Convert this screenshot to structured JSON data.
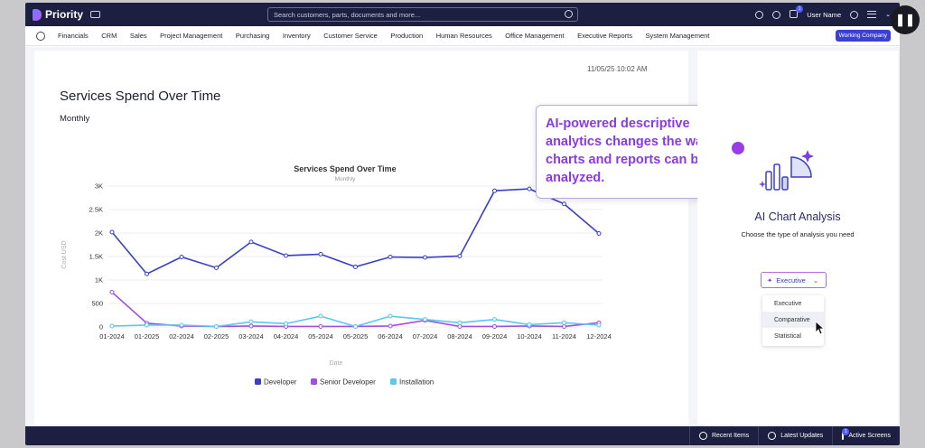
{
  "app": {
    "name": "Priority"
  },
  "search": {
    "placeholder": "Search customers, parts, documents and more..."
  },
  "header": {
    "user_name": "User Name",
    "notification_count": "1"
  },
  "nav": {
    "items": [
      "Financials",
      "CRM",
      "Sales",
      "Project Management",
      "Purchasing",
      "Inventory",
      "Customer Service",
      "Production",
      "Human Resources",
      "Office Management",
      "Executive Reports",
      "System Management"
    ],
    "company_button": "Working Company"
  },
  "report": {
    "timestamp": "11/05/25 10:02 AM",
    "title": "Services Spend Over Time",
    "subtitle": "Monthly"
  },
  "callout": {
    "text": "AI-powered descriptive analytics changes the way charts and reports can be analyzed."
  },
  "ai_panel": {
    "title": "AI Chart Analysis",
    "subtitle": "Choose the type of analysis you need",
    "selected": "Executive",
    "options": [
      "Executive",
      "Comparative",
      "Statistical"
    ]
  },
  "footer": {
    "recent": "Recent Items",
    "updates": "Latest Updates",
    "active": "Active Screens",
    "active_count": "1"
  },
  "colors": {
    "accent": "#3c3fd6",
    "developer": "#3b3fc4",
    "senior_developer": "#a24ee0",
    "installation": "#5ac8f0",
    "callout_text": "#8b3ae2"
  },
  "chart_data": {
    "type": "line",
    "title": "Services Spend Over Time",
    "subtitle": "Monthly",
    "xlabel": "Date",
    "ylabel": "Cost USD",
    "ylim": [
      0,
      3000
    ],
    "yticks": [
      "0",
      "500",
      "1K",
      "1.5K",
      "2K",
      "2.5K",
      "3K"
    ],
    "grid": true,
    "legend_position": "bottom",
    "categories": [
      "01-2024",
      "01-2025",
      "02-2024",
      "02-2025",
      "03-2024",
      "04-2024",
      "05-2024",
      "05-2025",
      "06-2024",
      "07-2024",
      "08-2024",
      "09-2024",
      "10-2024",
      "11-2024",
      "12-2024"
    ],
    "series": [
      {
        "name": "Developer",
        "color": "#3b3fc4",
        "values": [
          2020,
          1130,
          1490,
          1260,
          1810,
          1520,
          1550,
          1280,
          1490,
          1480,
          1510,
          2900,
          2940,
          2620,
          1990
        ]
      },
      {
        "name": "Senior Developer",
        "color": "#a24ee0",
        "values": [
          740,
          80,
          20,
          10,
          20,
          10,
          10,
          10,
          20,
          140,
          10,
          10,
          20,
          10,
          90
        ]
      },
      {
        "name": "Installation",
        "color": "#5ac8f0",
        "values": [
          20,
          40,
          40,
          10,
          110,
          70,
          230,
          10,
          230,
          160,
          90,
          160,
          50,
          90,
          40
        ]
      }
    ]
  }
}
